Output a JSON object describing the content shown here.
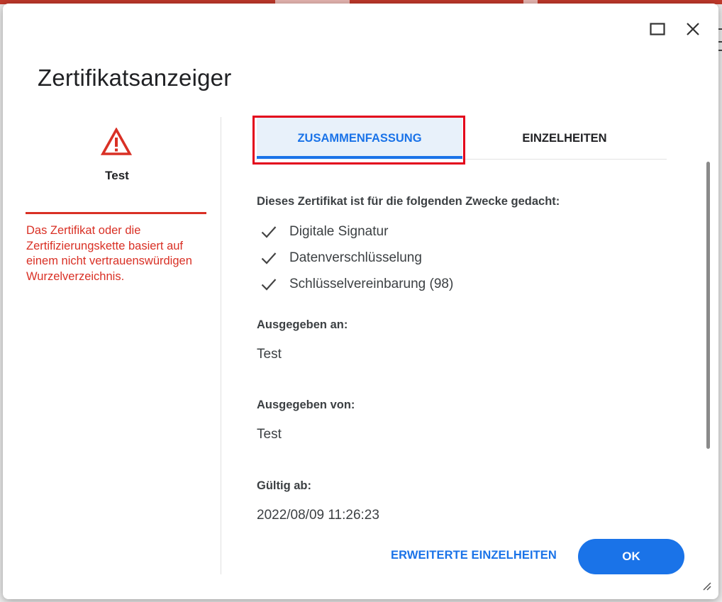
{
  "dialog": {
    "title": "Zertifikatsanzeiger",
    "window_controls": [
      "maximize-icon",
      "close-icon"
    ]
  },
  "left_panel": {
    "icon": "warning-icon",
    "subject": "Test",
    "error_message": "Das Zertifikat oder die Zertifizierungskette basiert auf einem nicht vertrauenswürdigen Wurzelverzeichnis."
  },
  "tabs": [
    {
      "label": "ZUSAMMENFASSUNG",
      "selected": true
    },
    {
      "label": "EINZELHEITEN",
      "selected": false
    }
  ],
  "summary": {
    "purposes_heading": "Dieses Zertifikat ist für die folgenden Zwecke gedacht:",
    "purposes": [
      "Digitale Signatur",
      "Datenverschlüsselung",
      "Schlüsselvereinbarung (98)"
    ],
    "issued_to_label": "Ausgegeben an:",
    "issued_to_value": "Test",
    "issued_by_label": "Ausgegeben von:",
    "issued_by_value": "Test",
    "valid_from_label": "Gültig ab:",
    "valid_from_value": "2022/08/09 11:26:23"
  },
  "footer": {
    "advanced_label": "ERWEITERTE EINZELHEITEN",
    "ok_label": "OK"
  },
  "colors": {
    "accent": "#1a73e8",
    "error": "#d93025",
    "highlight": "#e3001b",
    "selected_tab_bg": "#e8f1fa"
  }
}
